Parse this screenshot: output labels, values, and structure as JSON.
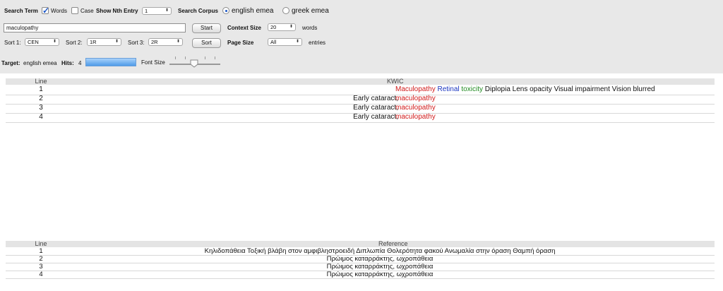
{
  "toolbar": {
    "search_term_label": "Search Term",
    "words_label": "Words",
    "words_checked": true,
    "case_label": "Case",
    "case_checked": false,
    "show_nth_label": "Show Nth Entry",
    "nth_value": "1",
    "search_corpus_label": "Search Corpus",
    "corpus_options": [
      "english emea",
      "greek emea"
    ],
    "corpus_selected": "english emea",
    "search_value": "maculopathy",
    "start_label": "Start",
    "context_size_label": "Context Size",
    "context_size_value": "20",
    "words_unit": "words",
    "sort1_label": "Sort 1:",
    "sort1_value": "CEN",
    "sort2_label": "Sort 2:",
    "sort2_value": "1R",
    "sort3_label": "Sort 3:",
    "sort3_value": "2R",
    "sort_label": "Sort",
    "page_size_label": "Page Size",
    "page_size_value": "All",
    "entries_unit": "entries",
    "target_label": "Target:",
    "target_value": "english emea",
    "hits_label": "Hits:",
    "hits_value": "4",
    "font_size_label": "Font Size"
  },
  "kwic_table": {
    "headers": {
      "line": "Line",
      "kwic": "KWIC"
    },
    "rows": [
      {
        "line": "1",
        "left": "",
        "keyword": "Maculopathy",
        "right_parts": [
          {
            "text": "Retinal",
            "color": "#1a35c0"
          },
          {
            "text": "toxicity",
            "color": "#1f8a1f"
          },
          {
            "text": "Diplopia Lens opacity Visual impairment Vision blurred",
            "color": "#111111"
          }
        ]
      },
      {
        "line": "2",
        "left": "Early cataract,",
        "keyword": "maculopathy",
        "right_parts": []
      },
      {
        "line": "3",
        "left": "Early cataract,",
        "keyword": "maculopathy",
        "right_parts": []
      },
      {
        "line": "4",
        "left": "Early cataract,",
        "keyword": "maculopathy",
        "right_parts": []
      }
    ]
  },
  "reference_table": {
    "headers": {
      "line": "Line",
      "reference": "Reference"
    },
    "rows": [
      {
        "line": "1",
        "text": "Κηλιδοπάθεια Τοξική βλάβη στον αμφιβληστροειδή Διπλωπία Θολερότητα φακού Ανωμαλία στην όραση Θαμπή όραση"
      },
      {
        "line": "2",
        "text": "Πρώιμος καταρράκτης, ωχροπάθεια"
      },
      {
        "line": "3",
        "text": "Πρώιμος καταρράκτης, ωχροπάθεια"
      },
      {
        "line": "4",
        "text": "Πρώιμος καταρράκτης, ωχροπάθεια"
      }
    ]
  },
  "colors": {
    "keyword": "#d01818",
    "accent": "#1a56c8",
    "hits_bar": "#5aa7ef"
  }
}
